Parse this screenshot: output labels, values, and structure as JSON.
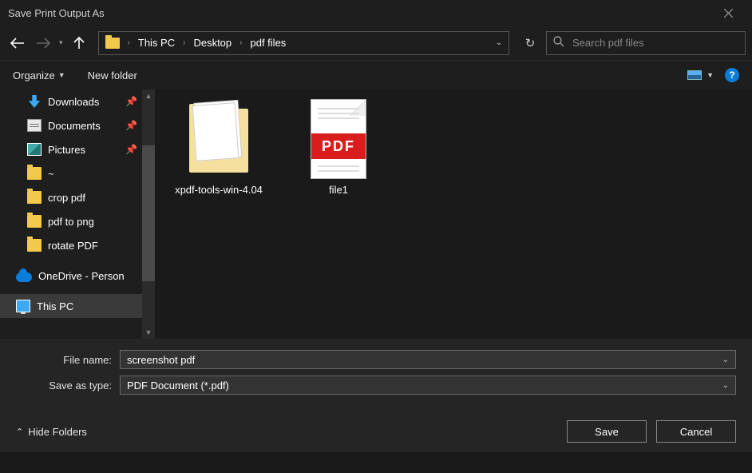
{
  "window": {
    "title": "Save Print Output As"
  },
  "address": {
    "root": "This PC",
    "crumbs": [
      "Desktop",
      "pdf files"
    ]
  },
  "search": {
    "placeholder": "Search pdf files"
  },
  "toolbar": {
    "organize": "Organize",
    "new_folder": "New folder"
  },
  "tree": [
    {
      "icon": "download",
      "label": "Downloads",
      "pinned": true
    },
    {
      "icon": "document",
      "label": "Documents",
      "pinned": true
    },
    {
      "icon": "pictures",
      "label": "Pictures",
      "pinned": true
    },
    {
      "icon": "folder",
      "label": "~"
    },
    {
      "icon": "folder",
      "label": "crop pdf"
    },
    {
      "icon": "folder",
      "label": "pdf to png"
    },
    {
      "icon": "folder",
      "label": "rotate PDF"
    },
    {
      "icon": "onedrive",
      "label": "OneDrive - Person",
      "group": true
    },
    {
      "icon": "thispc",
      "label": "This PC",
      "selected": true,
      "group": true
    }
  ],
  "files": [
    {
      "type": "folder",
      "name": "xpdf-tools-win-4.04"
    },
    {
      "type": "pdf",
      "name": "file1",
      "badge": "PDF"
    }
  ],
  "filename": {
    "label": "File name:",
    "value": "screenshot pdf"
  },
  "savetype": {
    "label": "Save as type:",
    "value": "PDF Document (*.pdf)"
  },
  "footer": {
    "hide": "Hide Folders",
    "save": "Save",
    "cancel": "Cancel"
  },
  "help": "?"
}
